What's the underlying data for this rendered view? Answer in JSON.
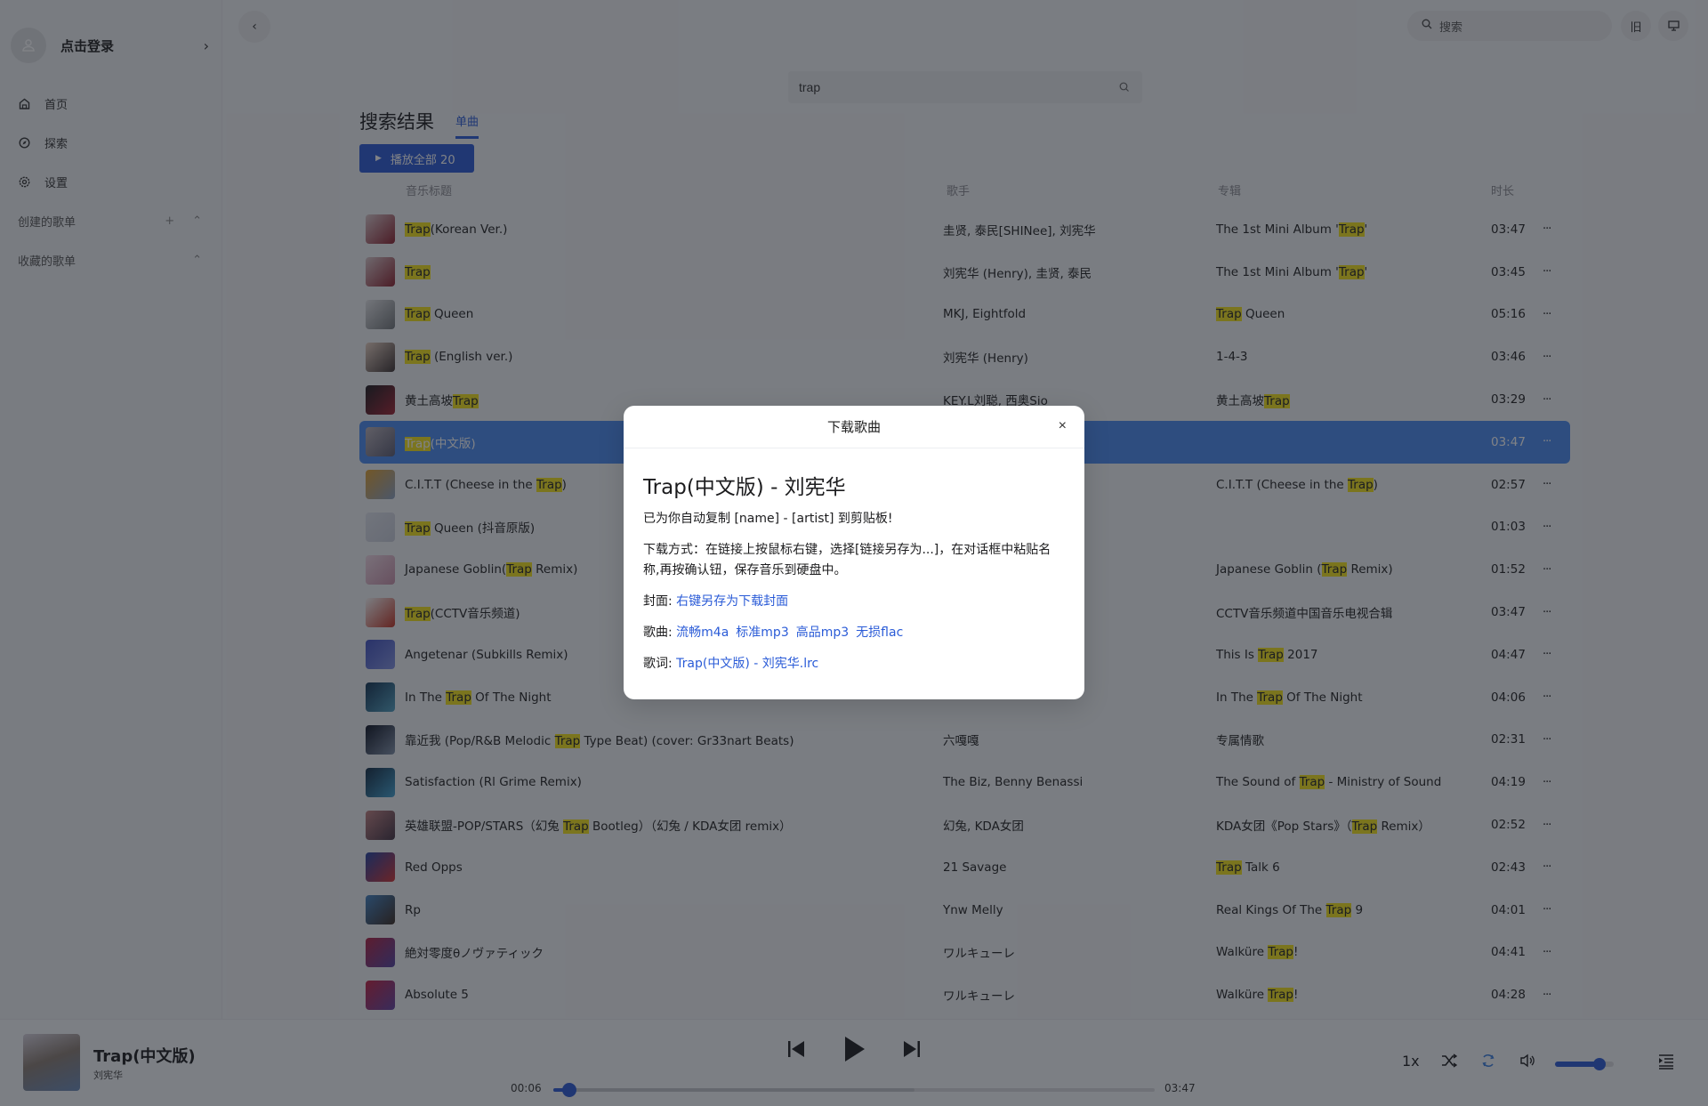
{
  "sidebar": {
    "login_label": "点击登录",
    "nav": [
      {
        "label": "首页",
        "icon": "home-icon"
      },
      {
        "label": "探索",
        "icon": "compass-icon"
      },
      {
        "label": "设置",
        "icon": "gear-icon"
      }
    ],
    "created_playlists_label": "创建的歌单",
    "collected_playlists_label": "收藏的歌单"
  },
  "topbar": {
    "search_placeholder": "搜索",
    "btn_old": "旧",
    "btn_screen_icon": "monitor-icon"
  },
  "search": {
    "query": "trap"
  },
  "results": {
    "title": "搜索结果",
    "tab": "单曲",
    "play_all_label": "播放全部 20",
    "columns": {
      "title": "音乐标题",
      "artist": "歌手",
      "album": "专辑",
      "duration": "时长"
    },
    "highlight_term": "Trap",
    "highlight_color": "#f4e21a",
    "selected_index": 5,
    "songs": [
      {
        "title": "Trap(Korean Ver.)",
        "artist": "圭贤, 泰民[SHINee], 刘宪华",
        "album": "The 1st Mini Album 'Trap'",
        "duration": "03:47",
        "cover": [
          "#d9c7c9",
          "#8b1e2c"
        ]
      },
      {
        "title": "Trap",
        "artist": "刘宪华 (Henry), 圭贤, 泰民",
        "album": "The 1st Mini Album 'Trap'",
        "duration": "03:45",
        "cover": [
          "#d9c7c9",
          "#8b1e2c"
        ]
      },
      {
        "title": "Trap Queen",
        "artist": "MKJ, Eightfold",
        "album": "Trap Queen",
        "duration": "05:16",
        "cover": [
          "#e4e4e6",
          "#707477"
        ]
      },
      {
        "title": "Trap (English ver.)",
        "artist": "刘宪华 (Henry)",
        "album": "1-4-3",
        "duration": "03:46",
        "cover": [
          "#e8d0c0",
          "#3a3030"
        ]
      },
      {
        "title": "黄土高坡Trap",
        "artist": "KEY.L刘聪, 西奥Sio",
        "album": "黄土高坡Trap",
        "duration": "03:29",
        "cover": [
          "#1a1a1e",
          "#a02030"
        ]
      },
      {
        "title": "Trap(中文版)",
        "artist": "",
        "album": "",
        "duration": "03:47",
        "cover": [
          "#b8b0b8",
          "#5a5a70"
        ]
      },
      {
        "title": "C.I.T.T (Cheese in the Trap)",
        "artist": "",
        "album": "C.I.T.T (Cheese in the Trap)",
        "duration": "02:57",
        "cover": [
          "#e0a030",
          "#8aa0c0"
        ]
      },
      {
        "title": "Trap Queen (抖音原版)",
        "artist": "",
        "album": "",
        "duration": "01:03",
        "cover": [
          "#dfe2ea",
          "#c8ccd8"
        ]
      },
      {
        "title": "Japanese Goblin(Trap Remix)",
        "artist": "",
        "album": "Japanese Goblin (Trap Remix)",
        "duration": "01:52",
        "cover": [
          "#f0d8e4",
          "#c890a8"
        ]
      },
      {
        "title": "Trap(CCTV音乐频道)",
        "artist": "",
        "album": "CCTV音乐频道中国音乐电视合辑",
        "duration": "03:47",
        "cover": [
          "#f5f5f5",
          "#c03020"
        ]
      },
      {
        "title": "Angetenar (Subkills Remix)",
        "artist": "",
        "album": "This Is Trap 2017",
        "duration": "04:47",
        "cover": [
          "#4050c0",
          "#8090e0"
        ]
      },
      {
        "title": "In The Trap Of The Night",
        "artist": "",
        "album": "In The Trap Of The Night",
        "duration": "04:06",
        "cover": [
          "#103050",
          "#50a0c0"
        ]
      },
      {
        "title": "靠近我 (Pop/R&B Melodic Trap Type Beat) (cover: Gr33nart Beats)",
        "artist": "六嘎嘎",
        "album": "专属情歌",
        "duration": "02:31",
        "cover": [
          "#0a1020",
          "#8090a8"
        ]
      },
      {
        "title": "Satisfaction (Rl Grime Remix)",
        "artist": "The Biz, Benny Benassi",
        "album": "The Sound of Trap - Ministry of Sound",
        "duration": "04:19",
        "cover": [
          "#102840",
          "#40a0d0"
        ]
      },
      {
        "title": "英雄联盟-POP/STARS（幻兔 Trap Bootleg）（幻兔 / KDA女团 remix）",
        "artist": "幻兔, KDA女团",
        "album": "KDA女团《Pop Stars》（Trap Remix）",
        "duration": "02:52",
        "cover": [
          "#c08080",
          "#403040"
        ]
      },
      {
        "title": "Red Opps",
        "artist": "21 Savage",
        "album": "Trap Talk 6",
        "duration": "02:43",
        "cover": [
          "#2040a0",
          "#d03030"
        ]
      },
      {
        "title": "Rp",
        "artist": "Ynw Melly",
        "album": "Real Kings Of The Trap 9",
        "duration": "04:01",
        "cover": [
          "#4080c0",
          "#3a2a20"
        ]
      },
      {
        "title": "絶対零度θノヴァティック",
        "artist": "ワルキューレ",
        "album": "Walküre Trap!",
        "duration": "04:41",
        "cover": [
          "#b02040",
          "#5040a0"
        ]
      },
      {
        "title": "Absolute 5",
        "artist": "ワルキューレ",
        "album": "Walküre Trap!",
        "duration": "04:28",
        "cover": [
          "#c02040",
          "#6040a0"
        ]
      }
    ]
  },
  "player": {
    "title": "Trap(中文版)",
    "artist": "刘宪华",
    "current_time": "00:06",
    "total_time": "03:47",
    "progress_fraction": 0.027,
    "buffered_fraction": 0.6,
    "speed_label": "1x",
    "volume_fraction": 0.75,
    "accent_color": "#2c5ad6"
  },
  "modal": {
    "title": "下载歌曲",
    "close_label": "×",
    "song_heading": "Trap(中文版) - 刘宪华",
    "clipboard_notice": "已为你自动复制 [name] - [artist] 到剪贴板!",
    "instructions": "下载方式：在链接上按鼠标右键，选择[链接另存为...]，在对话框中粘贴名称,再按确认钮，保存音乐到硬盘中。",
    "cover_label": "封面: ",
    "cover_link": "右键另存为下载封面",
    "song_label": "歌曲: ",
    "song_links": [
      "流畅m4a",
      "标准mp3",
      "高品mp3",
      "无损flac"
    ],
    "lyrics_label": "歌词: ",
    "lyrics_link": "Trap(中文版) - 刘宪华.lrc",
    "link_color": "#2a5bd7"
  }
}
